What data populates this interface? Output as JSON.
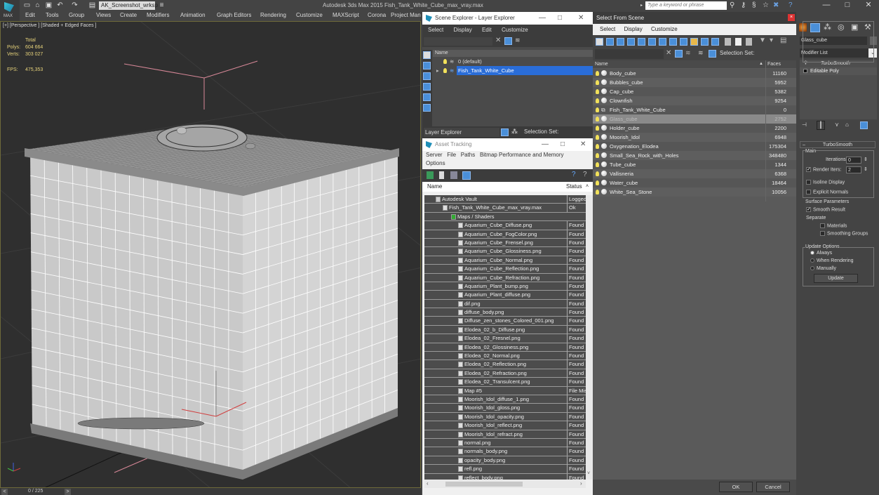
{
  "app": {
    "logo_label": "MAX",
    "project_dropdown": "AK_Screenshot_wrksp",
    "window_title": "Autodesk 3ds Max  2015    Fish_Tank_White_Cube_max_vray.max",
    "search_placeholder": "Type a keyword or phrase",
    "menus": [
      "Edit",
      "Tools",
      "Group",
      "Views",
      "Create",
      "Modifiers",
      "Animation",
      "Graph Editors",
      "Rendering",
      "Customize",
      "MAXScript",
      "Corona",
      "Project Man"
    ],
    "window_buttons": {
      "minimize": "—",
      "maximize": "□",
      "close": "✕"
    }
  },
  "viewport": {
    "label": "[+] [Perspective ] [Shaded + Edged Faces ]",
    "stats": {
      "header": "Total",
      "polys_label": "Polys:",
      "polys_value": "604 664",
      "verts_label": "Verts:",
      "verts_value": "303 027",
      "fps_label": "FPS:",
      "fps_value": "475,353"
    },
    "axis_labels": {
      "x": "x",
      "y": "y",
      "z": "z"
    }
  },
  "timeline": {
    "prev": "<",
    "frame": "0 / 225",
    "next": ">"
  },
  "scene_explorer": {
    "title": "Scene Explorer - Layer Explorer",
    "menus": [
      "Select",
      "Display",
      "Edit",
      "Customize"
    ],
    "column_name": "Name",
    "rows": [
      {
        "label": "0 (default)",
        "selected": false
      },
      {
        "label": "Fish_Tank_White_Cube",
        "selected": true
      }
    ],
    "footer_dropdown": "Layer Explorer",
    "selection_set_label": "Selection Set:"
  },
  "asset_tracking": {
    "title": "Asset Tracking",
    "menus": [
      "Server",
      "File",
      "Paths",
      "Bitmap Performance and Memory",
      "Options"
    ],
    "columns": {
      "name": "Name",
      "status": "Status"
    },
    "rows": [
      {
        "name": "Autodesk Vault",
        "status": "Logged",
        "indent": 1
      },
      {
        "name": "Fish_Tank_White_Cube_max_vray.max",
        "status": "Ok",
        "indent": 2
      },
      {
        "name": "Maps / Shaders",
        "status": "",
        "indent": 3
      },
      {
        "name": "Aquarium_Cube_Diffuse.png",
        "status": "Found",
        "indent": 4
      },
      {
        "name": "Aquarium_Cube_FogColor.png",
        "status": "Found",
        "indent": 4
      },
      {
        "name": "Aquarium_Cube_Frensel.png",
        "status": "Found",
        "indent": 4
      },
      {
        "name": "Aquarium_Cube_Glossiness.png",
        "status": "Found",
        "indent": 4
      },
      {
        "name": "Aquarium_Cube_Normal.png",
        "status": "Found",
        "indent": 4
      },
      {
        "name": "Aquarium_Cube_Reflection.png",
        "status": "Found",
        "indent": 4
      },
      {
        "name": "Aquarium_Cube_Refraction.png",
        "status": "Found",
        "indent": 4
      },
      {
        "name": "Aquarium_Plant_bump.png",
        "status": "Found",
        "indent": 4
      },
      {
        "name": "Aquarium_Plant_diffuse.png",
        "status": "Found",
        "indent": 4
      },
      {
        "name": "dif.png",
        "status": "Found",
        "indent": 4
      },
      {
        "name": "diffuse_body.png",
        "status": "Found",
        "indent": 4
      },
      {
        "name": "Diffuse_zen_stones_Colored_001.png",
        "status": "Found",
        "indent": 4
      },
      {
        "name": "Elodea_02_b_Diffuse.png",
        "status": "Found",
        "indent": 4
      },
      {
        "name": "Elodea_02_Fresnel.png",
        "status": "Found",
        "indent": 4
      },
      {
        "name": "Elodea_02_Glossiness.png",
        "status": "Found",
        "indent": 4
      },
      {
        "name": "Elodea_02_Normal.png",
        "status": "Found",
        "indent": 4
      },
      {
        "name": "Elodea_02_Reflection.png",
        "status": "Found",
        "indent": 4
      },
      {
        "name": "Elodea_02_Refraction.png",
        "status": "Found",
        "indent": 4
      },
      {
        "name": "Elodea_02_Transulcent.png",
        "status": "Found",
        "indent": 4
      },
      {
        "name": "Map #5",
        "status": "File Mis",
        "indent": 4
      },
      {
        "name": "Moorish_Idol_diffuse_1.png",
        "status": "Found",
        "indent": 4
      },
      {
        "name": "Moorish_Idol_gloss.png",
        "status": "Found",
        "indent": 4
      },
      {
        "name": "Moorish_Idol_opacity.png",
        "status": "Found",
        "indent": 4
      },
      {
        "name": "Moorish_Idol_reflect.png",
        "status": "Found",
        "indent": 4
      },
      {
        "name": "Moorish_Idol_refract.png",
        "status": "Found",
        "indent": 4
      },
      {
        "name": "normal.png",
        "status": "Found",
        "indent": 4
      },
      {
        "name": "normals_body.png",
        "status": "Found",
        "indent": 4
      },
      {
        "name": "opacity_body.png",
        "status": "Found",
        "indent": 4
      },
      {
        "name": "refl.png",
        "status": "Found",
        "indent": 4
      },
      {
        "name": "reflect_body.png",
        "status": "Found",
        "indent": 4
      }
    ]
  },
  "select_from_scene": {
    "title": "Select From Scene",
    "menus": [
      "Select",
      "Display",
      "Customize"
    ],
    "selection_set_label": "Selection Set:",
    "columns": {
      "name": "Name",
      "faces": "Faces"
    },
    "rows": [
      {
        "name": "Body_cube",
        "faces": "11160",
        "selected": false
      },
      {
        "name": "Bubbles_cube",
        "faces": "5952",
        "selected": false
      },
      {
        "name": "Cap_cube",
        "faces": "5382",
        "selected": false
      },
      {
        "name": "Clownfish",
        "faces": "9254",
        "selected": false
      },
      {
        "name": "Fish_Tank_White_Cube",
        "faces": "0",
        "selected": false,
        "group": true
      },
      {
        "name": "Glass_cube",
        "faces": "2752",
        "selected": true
      },
      {
        "name": "Holder_cube",
        "faces": "2200",
        "selected": false
      },
      {
        "name": "Moorish_Idol",
        "faces": "6948",
        "selected": false
      },
      {
        "name": "Oxygenation_Elodea",
        "faces": "175304",
        "selected": false
      },
      {
        "name": "Small_Sea_Rock_with_Holes",
        "faces": "348480",
        "selected": false
      },
      {
        "name": "Tube_cube",
        "faces": "1344",
        "selected": false
      },
      {
        "name": "Vallisneria",
        "faces": "6368",
        "selected": false
      },
      {
        "name": "Water_cube",
        "faces": "18464",
        "selected": false
      },
      {
        "name": "White_Sea_Stone",
        "faces": "10056",
        "selected": false
      }
    ],
    "ok_label": "OK",
    "cancel_label": "Cancel"
  },
  "command_panel": {
    "object_name": "Glass_cube",
    "modifier_list": "Modifier List",
    "stack": [
      "TurboSmooth",
      "Editable Poly"
    ],
    "rollout_title": "TurboSmooth",
    "main_group": "Main",
    "iterations_label": "Iterations:",
    "iterations_value": "0",
    "render_iters_label": "Render Iters:",
    "render_iters_value": "2",
    "render_iters_checked": true,
    "isoline_label": "Isoline Display",
    "isoline_checked": false,
    "explicit_normals_label": "Explicit Normals",
    "explicit_normals_checked": false,
    "surface_group": "Surface Parameters",
    "smooth_result_label": "Smooth Result",
    "smooth_result_checked": true,
    "separate_label": "Separate",
    "materials_label": "Materials",
    "smoothing_groups_label": "Smoothing Groups",
    "update_group": "Update Options",
    "update_always": "Always",
    "update_when_rendering": "When Rendering",
    "update_manually": "Manually",
    "update_button": "Update",
    "update_selected": "Always"
  }
}
